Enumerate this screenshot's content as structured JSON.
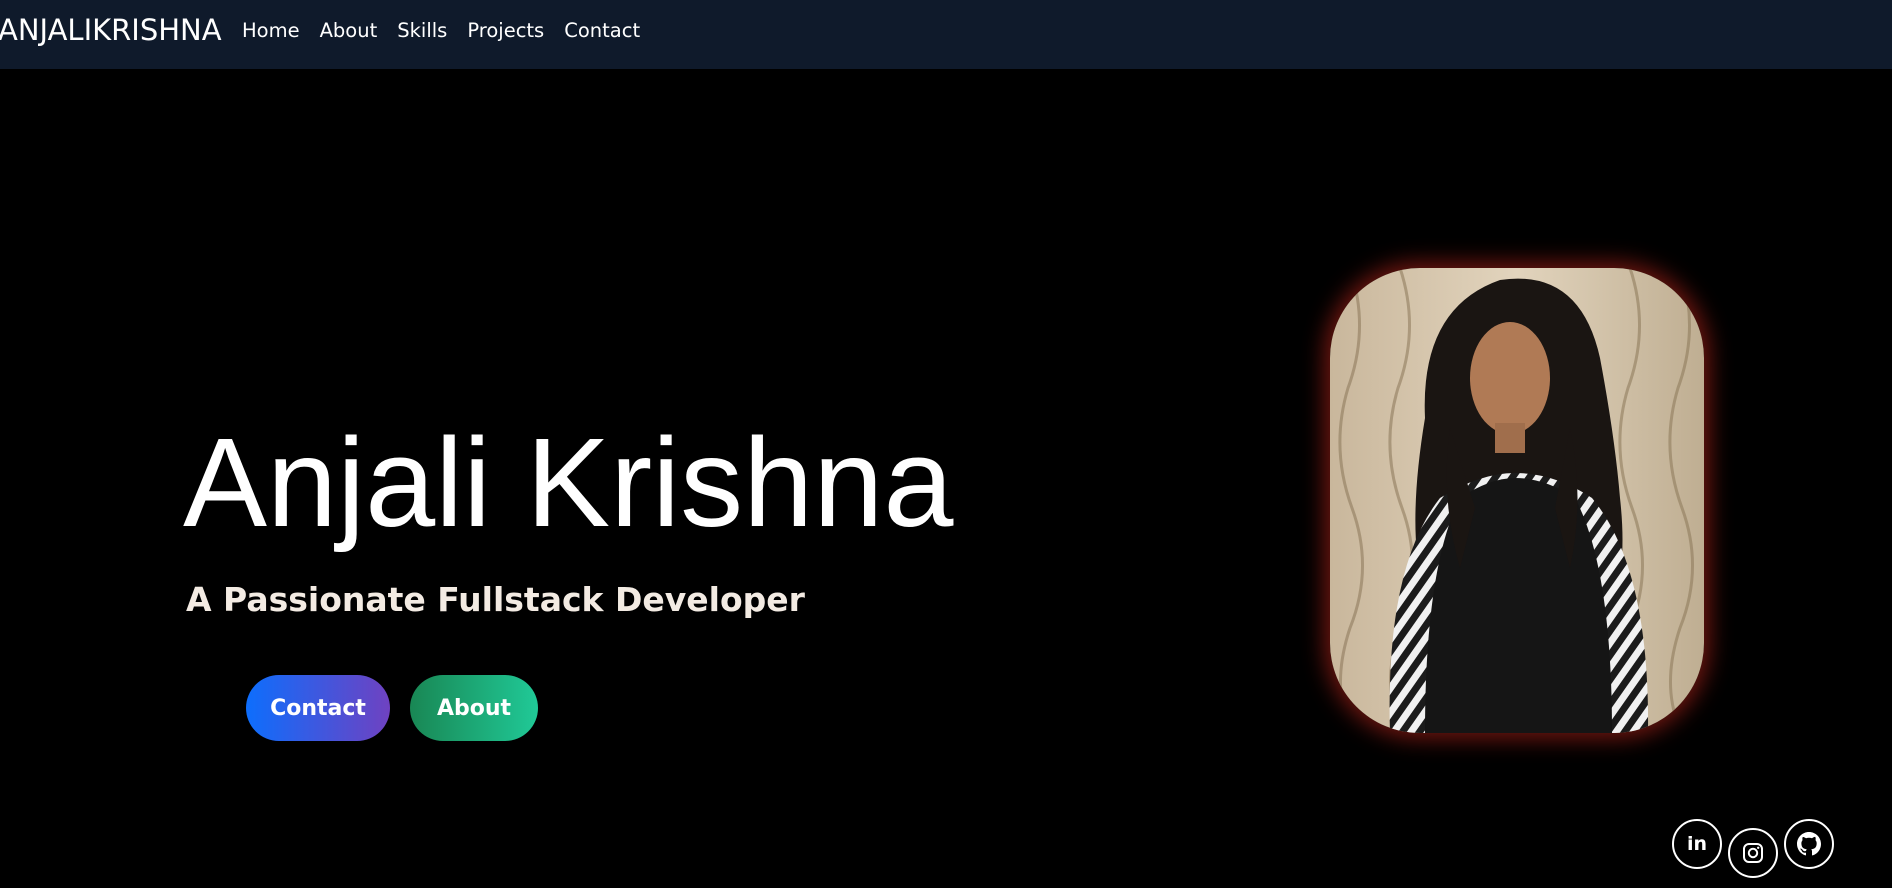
{
  "nav": {
    "brand": "ANJALIKRISHNA",
    "links": [
      "Home",
      "About",
      "Skills",
      "Projects",
      "Contact"
    ]
  },
  "hero": {
    "name": "Anjali Krishna",
    "subtitle": "A Passionate Fullstack Developer",
    "buttons": {
      "contact": "Contact",
      "about": "About"
    }
  },
  "social": {
    "linkedin_glyph": "in",
    "icons": [
      "linkedin-icon",
      "instagram-icon",
      "github-icon"
    ]
  },
  "colors": {
    "nav_bg": "#0f1a2b",
    "page_bg": "#000000",
    "contact_gradient": [
      "#0d6efd",
      "#6f42c1"
    ],
    "about_gradient": [
      "#198754",
      "#20c997"
    ],
    "portrait_glow": "#c8281e"
  }
}
